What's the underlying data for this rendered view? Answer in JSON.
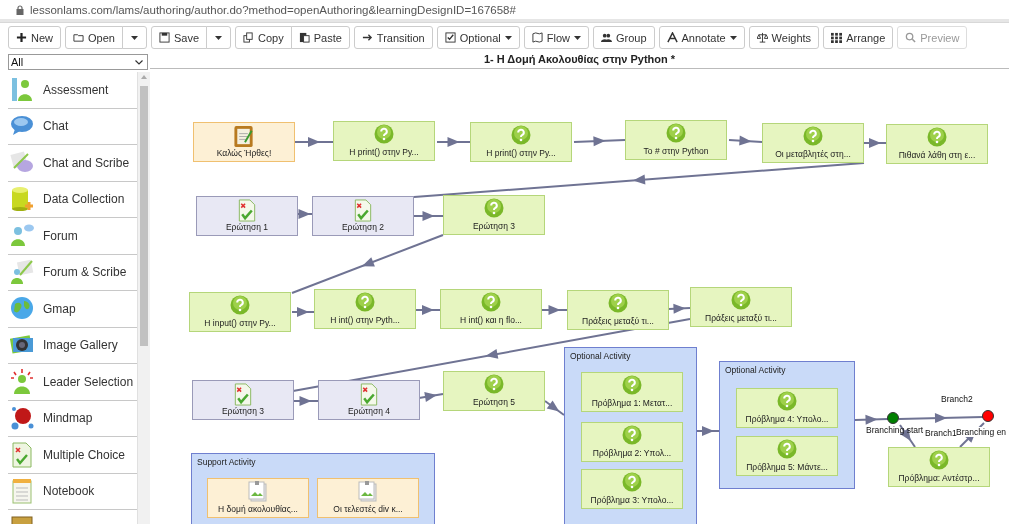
{
  "address_bar": {
    "url": "lessonlams.com/lams/authoring/author.do?method=openAuthoring&learningDesignID=167658#"
  },
  "toolbar": [
    [
      {
        "kind": "button",
        "label": "New"
      }
    ],
    [
      {
        "kind": "button",
        "label": "Open"
      },
      {
        "kind": "caret"
      }
    ],
    [
      {
        "kind": "button",
        "label": "Save"
      },
      {
        "kind": "caret"
      }
    ],
    [
      {
        "kind": "button",
        "label": "Copy"
      },
      {
        "kind": "button",
        "label": "Paste"
      }
    ],
    [
      {
        "kind": "button",
        "label": "Transition"
      }
    ],
    [
      {
        "kind": "menu",
        "label": "Optional"
      }
    ],
    [
      {
        "kind": "menu",
        "label": "Flow"
      }
    ],
    [
      {
        "kind": "button",
        "label": "Group"
      }
    ],
    [
      {
        "kind": "menu",
        "label": "Annotate"
      }
    ],
    [
      {
        "kind": "button",
        "label": "Weights"
      }
    ],
    [
      {
        "kind": "button",
        "label": "Arrange"
      }
    ],
    [
      {
        "kind": "button",
        "label": "Preview",
        "disabled": true
      }
    ]
  ],
  "palette": {
    "filter": "All",
    "items": [
      {
        "label": "Assessment"
      },
      {
        "label": "Chat"
      },
      {
        "label": "Chat and Scribe"
      },
      {
        "label": "Data Collection"
      },
      {
        "label": "Forum"
      },
      {
        "label": "Forum & Scribe"
      },
      {
        "label": "Gmap"
      },
      {
        "label": "Image Gallery"
      },
      {
        "label": "Leader Selection"
      },
      {
        "label": "Mindmap"
      },
      {
        "label": "Multiple Choice"
      },
      {
        "label": "Notebook"
      }
    ]
  },
  "design": {
    "title": "1- Η Δομή Ακολουθίας στην Python *",
    "activities": [
      {
        "kind": "notice",
        "label": "Καλώς Ήρθες!"
      },
      {
        "kind": "question",
        "label": "H print() στην Py..."
      },
      {
        "kind": "question",
        "label": "H print() στην Py..."
      },
      {
        "kind": "question",
        "label": "To # στην Python"
      },
      {
        "kind": "question",
        "label": "Οι μεταβλητές στη..."
      },
      {
        "kind": "question",
        "label": "Πιθανά λάθη στη ε..."
      },
      {
        "kind": "mcq",
        "label": "Ερώτηση 1"
      },
      {
        "kind": "mcq",
        "label": "Ερώτηση 2"
      },
      {
        "kind": "question",
        "label": "Ερώτηση 3"
      },
      {
        "kind": "question",
        "label": "H input() στην Py..."
      },
      {
        "kind": "question",
        "label": "H int() στην Pyth..."
      },
      {
        "kind": "question",
        "label": "H int() και η flo..."
      },
      {
        "kind": "question",
        "label": "Πράξεις μεταξύ τι..."
      },
      {
        "kind": "question",
        "label": "Πράξεις μεταξύ τι..."
      },
      {
        "kind": "mcq",
        "label": "Ερώτηση 3"
      },
      {
        "kind": "mcq",
        "label": "Ερώτηση 4"
      },
      {
        "kind": "question",
        "label": "Ερώτηση 5"
      }
    ],
    "groups": [
      {
        "label": "Optional Activity",
        "activities": [
          {
            "kind": "question",
            "label": "Πρόβλημα 1: Μετατ..."
          },
          {
            "kind": "question",
            "label": "Πρόβλημα 2: Υπολ..."
          },
          {
            "kind": "question",
            "label": "Πρόβλημα 3: Υπολο..."
          }
        ]
      },
      {
        "label": "Optional Activity",
        "activities": [
          {
            "kind": "question",
            "label": "Πρόβλημα 4: Υπολο..."
          },
          {
            "kind": "question",
            "label": "Πρόβλημα 5: Μάντε..."
          }
        ]
      },
      {
        "label": "Support Activity",
        "activities": [
          {
            "kind": "resource",
            "label": "Η δομή ακολουθίας..."
          },
          {
            "kind": "resource",
            "label": "Οι τελεστές div κ..."
          }
        ]
      }
    ],
    "branching": {
      "start": {
        "label": "Branching start",
        "color": "#008000"
      },
      "end": {
        "label": "Branching en",
        "color": "#ff0000"
      },
      "branches": [
        {
          "label": "Branch2"
        },
        {
          "label": "Branch1",
          "activities": [
            {
              "kind": "question",
              "label": "Πρόβλημα: Αντέστρ..."
            }
          ]
        }
      ]
    }
  }
}
